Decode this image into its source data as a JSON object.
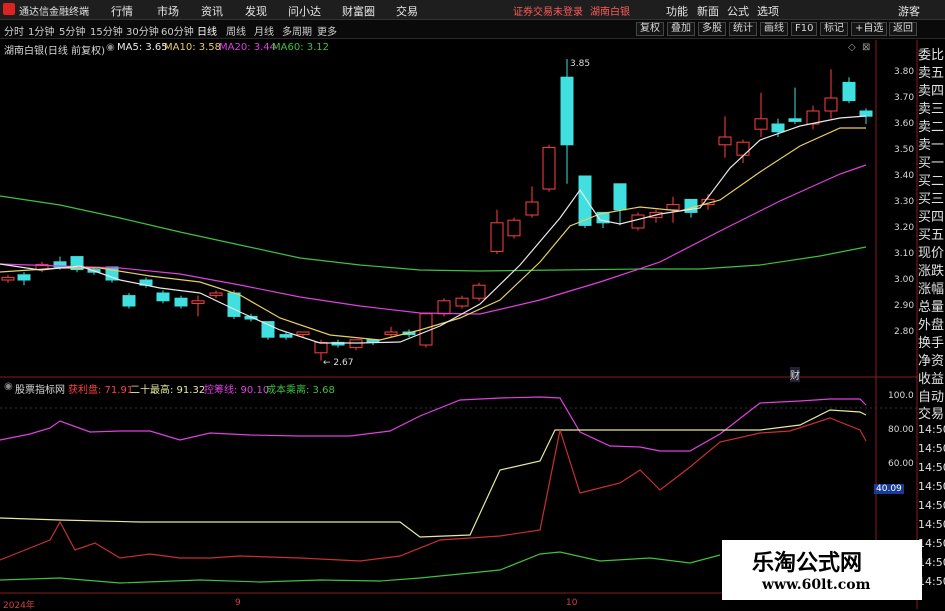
{
  "titlebar": {
    "app_name": "通达信金融终端",
    "menu": [
      "行情",
      "市场",
      "资讯",
      "发现",
      "问小达",
      "财富圈",
      "交易"
    ],
    "notice": "证券交易未登录",
    "stock_title": "湖南白银",
    "right_menu": [
      "功能",
      "新面",
      "公式",
      "选项"
    ],
    "guest": "游客"
  },
  "periods": [
    "分时",
    "1分钟",
    "5分钟",
    "15分钟",
    "30分钟",
    "60分钟",
    "日线",
    "周线",
    "月线",
    "多周期",
    "更多"
  ],
  "active_period": "日线",
  "chart_tools": [
    "复权",
    "叠加",
    "多股",
    "统计",
    "画线",
    "F10",
    "标记",
    "+自选",
    "返回"
  ],
  "stock_label": "湖南白银(日线 前复权)",
  "ma": {
    "ma5": "MA5: 3.65",
    "ma10": "MA10: 3.58",
    "ma20": "MA20: 3.44",
    "ma60": "MA60: 3.12"
  },
  "price_axis": [
    "3.80",
    "3.70",
    "3.60",
    "3.50",
    "3.40",
    "3.30",
    "3.20",
    "3.10",
    "3.00",
    "2.90",
    "2.80"
  ],
  "annotations": {
    "high": "3.85",
    "low": "2.67",
    "cai": "财"
  },
  "indicator": {
    "name": "股票指标网",
    "profit": "获利盘: 71.91",
    "high20": "二十最高: 91.32",
    "trap": "控筹线: 90.10",
    "cost": "成本乘离: 3.68"
  },
  "ind_axis": [
    "100.0",
    "80.00",
    "60.00",
    "40.09"
  ],
  "sidebar": [
    "委比",
    "卖五",
    "卖四",
    "卖三",
    "卖二",
    "卖一",
    "买一",
    "买二",
    "买三",
    "买四",
    "买五",
    "现价",
    "涨跌",
    "涨幅",
    "总量",
    "外盘",
    "换手",
    "净资",
    "收益"
  ],
  "sidebar_lower": [
    "自动",
    "交易"
  ],
  "times": [
    "14:50",
    "14:50",
    "14:50",
    "14:50",
    "14:50",
    "14:50",
    "14:50",
    "14:50",
    "14:50"
  ],
  "date_labels": [
    "2024年",
    "9",
    "10"
  ],
  "watermark": {
    "title": "乐淘公式网",
    "url": "www.60lt.com"
  },
  "colors": {
    "up": "#ff4040",
    "down": "#40e0e0",
    "ma5": "#e8e8e8",
    "ma10": "#e8d060",
    "ma20": "#e040e0",
    "ma60": "#40c040"
  },
  "icons": [
    "app-logo-icon",
    "chart-settings-icon",
    "diamond-icon",
    "close-icon"
  ]
}
